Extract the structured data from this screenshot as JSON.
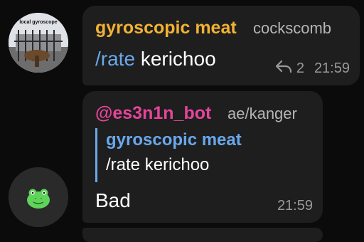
{
  "messages": [
    {
      "sender": "gyroscopic meat",
      "role": "cockscomb",
      "command": "/rate",
      "argument": "kerichoo",
      "reply_count": "2",
      "time": "21:59",
      "avatar_caption": "local gyroscope"
    },
    {
      "sender": "@es3n1n_bot",
      "role": "ae/kanger",
      "quote": {
        "author": "gyroscopic meat",
        "text": "/rate kerichoo"
      },
      "text": "Bad",
      "time": "21:59"
    }
  ],
  "colors": {
    "background": "#0b0b0b",
    "bubble": "#1e1e1e",
    "sender_1": "#f2b233",
    "sender_2": "#e4459a",
    "accent": "#6aa8ec",
    "muted": "#9a9a9a",
    "frog": "#5fd35a"
  },
  "icons": [
    "reply-arrow-icon",
    "frog-icon"
  ]
}
